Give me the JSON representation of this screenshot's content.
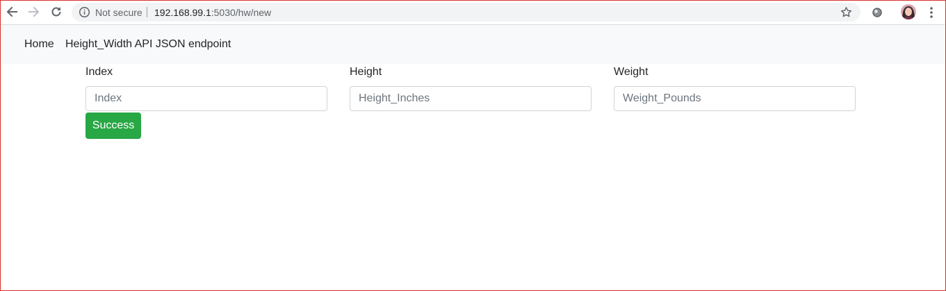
{
  "browser": {
    "security_label": "Not secure",
    "url_host": "192.168.99.1",
    "url_path": ":5030/hw/new"
  },
  "navbar": {
    "links": [
      {
        "label": "Home"
      },
      {
        "label": "Height_Width API JSON endpoint"
      }
    ]
  },
  "form": {
    "fields": [
      {
        "label": "Index",
        "placeholder": "Index",
        "value": ""
      },
      {
        "label": "Height",
        "placeholder": "Height_Inches",
        "value": ""
      },
      {
        "label": "Weight",
        "placeholder": "Weight_Pounds",
        "value": ""
      }
    ],
    "submit_label": "Success"
  },
  "colors": {
    "submit_button": "#28a745",
    "navbar_bg": "#f8f9fa",
    "frame_border": "#d9302c"
  },
  "icons": [
    "back-arrow-icon",
    "forward-arrow-icon",
    "reload-icon",
    "info-icon",
    "star-icon",
    "extension-icon",
    "avatar",
    "kebab-menu-icon"
  ]
}
